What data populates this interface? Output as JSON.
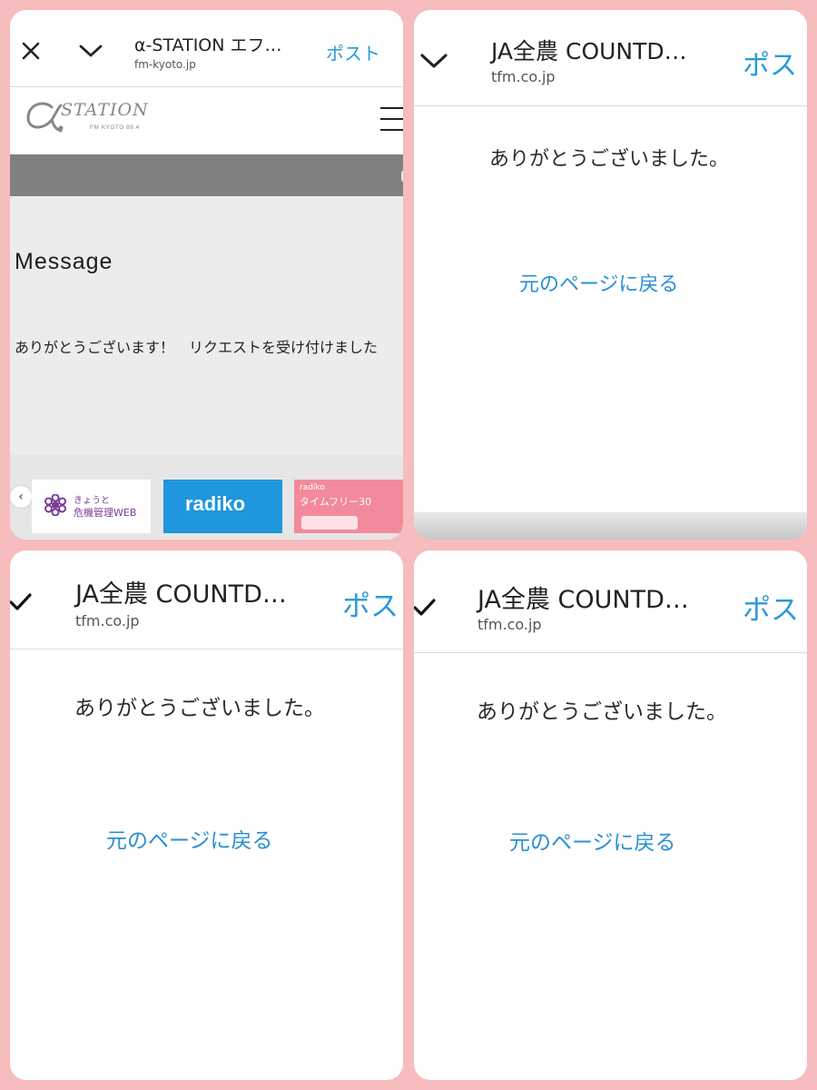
{
  "colors": {
    "background": "#f6bcbe",
    "link": "#2a8fd1",
    "radiko": "#1f96dd",
    "timefree": "#f28a9b"
  },
  "panel1": {
    "title": "α-STATION エフ…",
    "domain": "fm-kyoto.jp",
    "post": "ポスト",
    "logo_text": "STATION",
    "logo_sub": "FM KYOTO 89.4",
    "message_heading": "Message",
    "message_body": "ありがとうございます！　リクエストを受け付けました",
    "banners": {
      "kiki_line1": "きょうと",
      "kiki_line2": "危機管理WEB",
      "radiko": "radiko",
      "timefree_line1": "radiko",
      "timefree_line2": "タイムフリー30"
    },
    "prev_arrow": "‹"
  },
  "panel2": {
    "title": "JA全農 COUNTD…",
    "domain": "tfm.co.jp",
    "post": "ポス",
    "thanks": "ありがとうございました。",
    "back_link": "元のページに戻る"
  },
  "panel3": {
    "title": "JA全農 COUNTD…",
    "domain": "tfm.co.jp",
    "post": "ポス",
    "thanks": "ありがとうございました。",
    "back_link": "元のページに戻る"
  },
  "panel4": {
    "title": "JA全農 COUNTD…",
    "domain": "tfm.co.jp",
    "post": "ポス",
    "thanks": "ありがとうございました。",
    "back_link": "元のページに戻る"
  }
}
